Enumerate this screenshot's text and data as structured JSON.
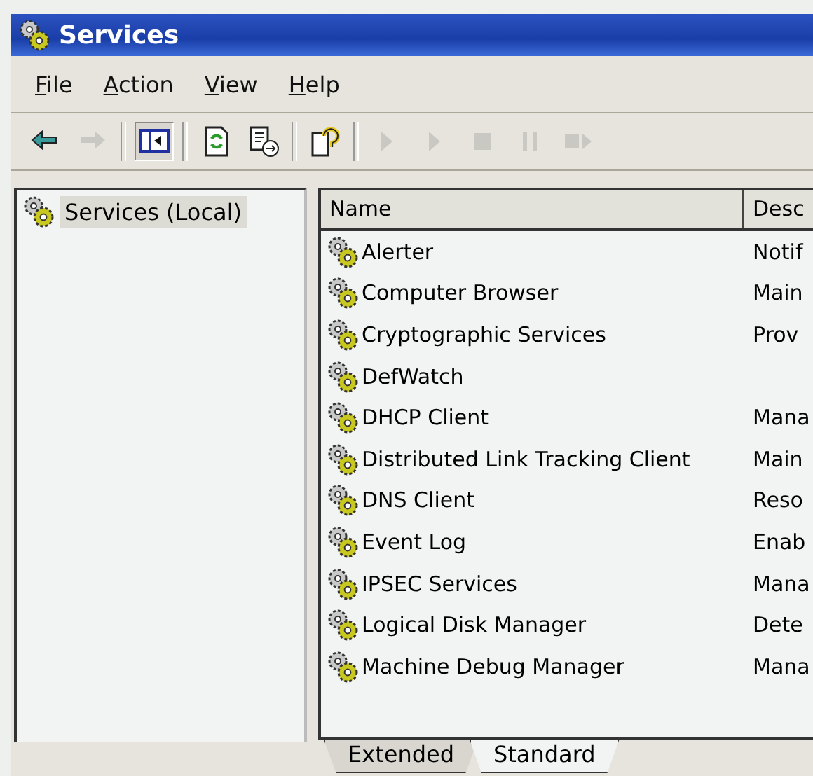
{
  "window": {
    "title": "Services"
  },
  "menu": [
    {
      "label": "File"
    },
    {
      "label": "Action"
    },
    {
      "label": "View"
    },
    {
      "label": "Help"
    }
  ],
  "toolbar": [
    {
      "kind": "back",
      "disabled": false,
      "pressed": false
    },
    {
      "kind": "forward",
      "disabled": true,
      "pressed": false
    },
    {
      "kind": "separator"
    },
    {
      "kind": "tree",
      "disabled": false,
      "pressed": true
    },
    {
      "kind": "separator"
    },
    {
      "kind": "refresh",
      "disabled": false,
      "pressed": false
    },
    {
      "kind": "export",
      "disabled": false,
      "pressed": false
    },
    {
      "kind": "separator"
    },
    {
      "kind": "help",
      "disabled": false,
      "pressed": false
    },
    {
      "kind": "separator"
    },
    {
      "kind": "start",
      "disabled": true,
      "pressed": false
    },
    {
      "kind": "start",
      "disabled": true,
      "pressed": false
    },
    {
      "kind": "stop",
      "disabled": true,
      "pressed": false
    },
    {
      "kind": "pause",
      "disabled": true,
      "pressed": false
    },
    {
      "kind": "restart",
      "disabled": true,
      "pressed": false
    }
  ],
  "tree": {
    "items": [
      {
        "label": "Services (Local)",
        "selected": true
      }
    ]
  },
  "table": {
    "columns": [
      "Name",
      "Desc"
    ],
    "rows": [
      {
        "name": "Alerter",
        "column_2": "Notif"
      },
      {
        "name": "Computer Browser",
        "column_2": "Main"
      },
      {
        "name": "Cryptographic Services",
        "column_2": "Prov"
      },
      {
        "name": "DefWatch"
      },
      {
        "name": "DHCP Client",
        "column_2": "Mana"
      },
      {
        "name": "Distributed Link Tracking Client",
        "column_2": "Main"
      },
      {
        "name": "DNS Client",
        "column_2": "Reso"
      },
      {
        "name": "Event Log",
        "column_2": "Enab"
      },
      {
        "name": "IPSEC Services",
        "column_2": "Mana"
      },
      {
        "name": "Logical Disk Manager",
        "column_2": "Dete"
      },
      {
        "name": "Machine Debug Manager",
        "column_2": "Mana"
      }
    ]
  },
  "tabs": [
    {
      "label": "Extended",
      "selected": false
    },
    {
      "label": "Standard",
      "selected": true
    }
  ]
}
